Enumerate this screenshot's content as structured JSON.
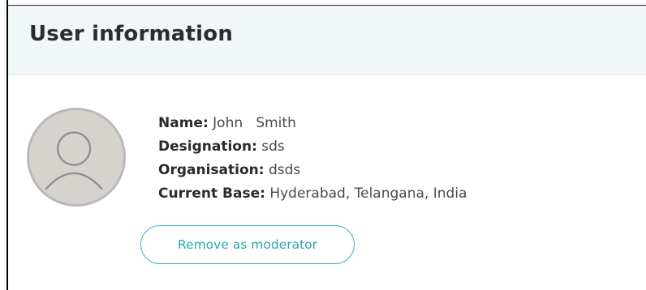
{
  "card": {
    "title": "User information"
  },
  "avatar": {
    "icon": "user-silhouette-icon"
  },
  "details": [
    {
      "label": "Name:",
      "value": "John   Smith"
    },
    {
      "label": "Designation:",
      "value": "sds"
    },
    {
      "label": "Organisation:",
      "value": "dsds"
    },
    {
      "label": "Current Base:",
      "value": "Hyderabad, Telangana, India"
    }
  ],
  "actions": {
    "remove_moderator_label": "Remove as moderator"
  },
  "colors": {
    "accent": "#2aa6ad",
    "header_bg": "#f1f7f8",
    "avatar_bg": "#d6d3ce"
  }
}
